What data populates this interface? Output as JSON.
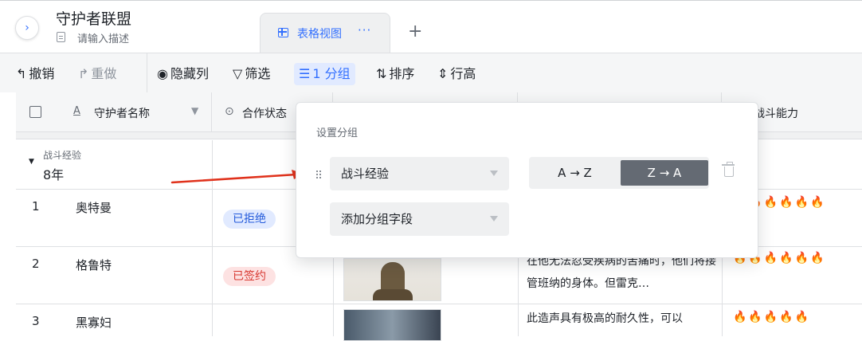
{
  "header": {
    "expand_glyph": "›",
    "title": "守护者联盟",
    "description_placeholder": "请输入描述",
    "view_tab_label": "表格视图",
    "view_tab_more": "···",
    "add_view_glyph": "+"
  },
  "toolbar": {
    "undo": "撤销",
    "redo": "重做",
    "hide_columns": "隐藏列",
    "filter": "筛选",
    "group": "1 分组",
    "sort": "排序",
    "row_height": "行高"
  },
  "table": {
    "columns": [
      "守护者名称",
      "合作状态",
      "战斗能力"
    ],
    "column_partial_last": "战斗能力",
    "group": {
      "field_label": "战斗经验",
      "value": "8年"
    },
    "rows": [
      {
        "num": "1",
        "name": "奥特曼",
        "status": "已拒绝",
        "status_color": "#e1eaff",
        "status_text_color": "#245bdb",
        "fires": "🔥🔥🔥🔥🔥🔥",
        "description": ""
      },
      {
        "num": "2",
        "name": "格鲁特",
        "status": "已签约",
        "status_color": "#fde2e2",
        "status_text_color": "#d83931",
        "fires": "🔥🔥🔥🔥🔥🔥",
        "description": "在他无法忍受疾病的苦痛时，他们将接管班纳的身体。但雷克…"
      },
      {
        "num": "3",
        "name": "黑寡妇",
        "status": "",
        "fires": "🔥🔥🔥🔥🔥",
        "description": "此造声具有极高的耐久性，可以"
      }
    ]
  },
  "popup": {
    "title": "设置分组",
    "group_field": "战斗经验",
    "add_field_placeholder": "添加分组字段",
    "sort_az": "A → Z",
    "sort_za": "Z → A",
    "sort_selected": "Z → A"
  },
  "colors": {
    "accent": "#3370ff",
    "arrow": "#e0321c"
  }
}
